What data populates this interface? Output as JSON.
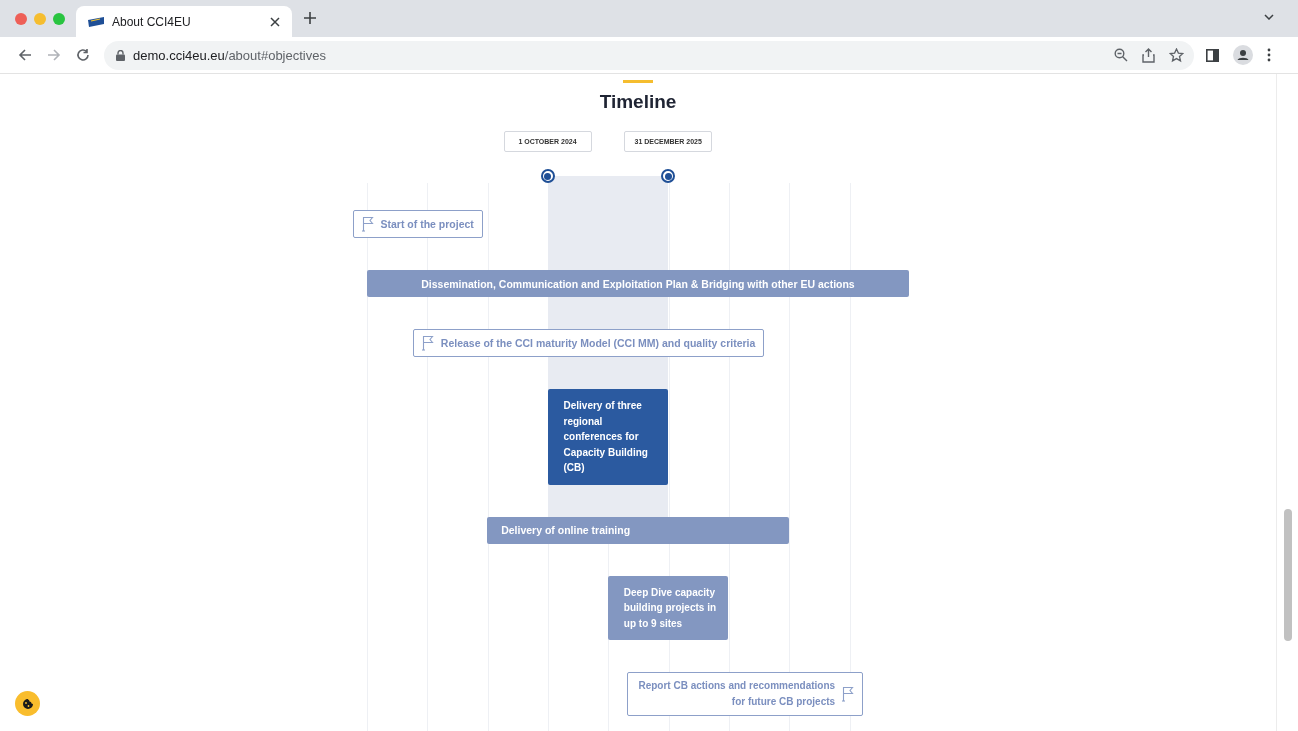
{
  "browser": {
    "tabs": [
      {
        "title": "About CCI4EU",
        "selected": true
      }
    ],
    "url": {
      "host": "demo.cci4eu.eu",
      "path": "/about#objectives"
    }
  },
  "section": {
    "title": "Timeline",
    "dates": [
      {
        "label": "1 OCTOBER 2024"
      },
      {
        "label": "31 DECEMBER 2025"
      }
    ],
    "items": [
      {
        "kind": "milestone",
        "text": "Start of the project"
      },
      {
        "kind": "bar",
        "text": "Dissemination, Communication and Exploitation Plan & Bridging with other EU actions",
        "highlighted": false
      },
      {
        "kind": "milestone",
        "text": "Release of the CCI maturity Model (CCI MM) and quality criteria"
      },
      {
        "kind": "block",
        "text": "Delivery of three regional conferences for Capacity Building (CB)",
        "highlighted": true
      },
      {
        "kind": "bar",
        "text": "Delivery of online training",
        "highlighted": false
      },
      {
        "kind": "block",
        "text": "Deep Dive capacity building projects in up to 9 sites",
        "highlighted": false
      },
      {
        "kind": "milestone-end",
        "text": "Report CB actions and recommendations for future CB projects"
      }
    ]
  }
}
